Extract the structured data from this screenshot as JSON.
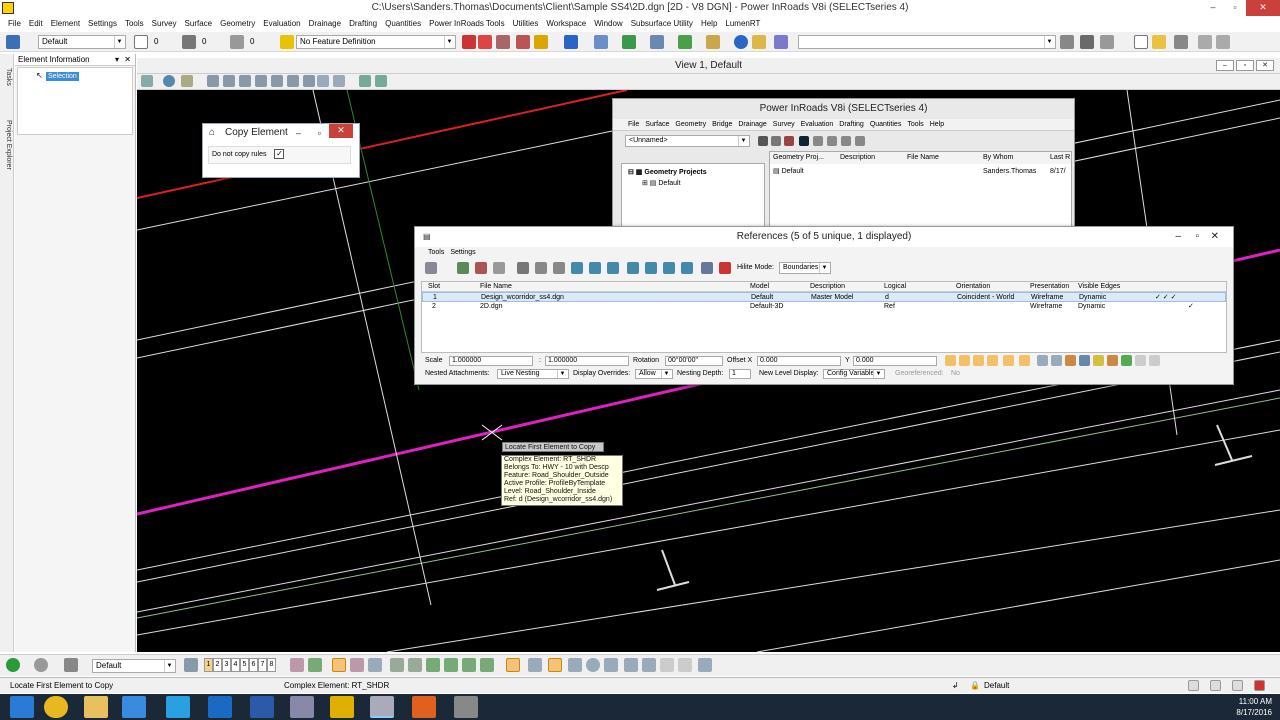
{
  "window": {
    "title": "C:\\Users\\Sanders.Thomas\\Documents\\Client\\Sample SS4\\2D.dgn [2D - V8 DGN] - Power InRoads V8i (SELECTseries 4)"
  },
  "menu": [
    "File",
    "Edit",
    "Element",
    "Settings",
    "Tools",
    "Survey",
    "Surface",
    "Geometry",
    "Evaluation",
    "Drainage",
    "Drafting",
    "Quantities",
    "Power InRoads Tools",
    "Utilities",
    "Workspace",
    "Window",
    "Subsurface Utility",
    "Help",
    "LumenRT"
  ],
  "toolbar": {
    "level": "Default",
    "color_value": "0",
    "weight_value": "0",
    "style_value": "0",
    "feature_definition": "No Feature Definition"
  },
  "side_tabs": [
    "Tasks",
    "Project Explorer"
  ],
  "element_info": {
    "title": "Element Information",
    "selection": "Selection"
  },
  "view": {
    "title": "View 1, Default"
  },
  "copy_element": {
    "title": "Copy Element",
    "option_label": "Do not copy rules",
    "checked": true,
    "check_mark": "✓"
  },
  "pir": {
    "title": "Power InRoads V8i (SELECTseries 4)",
    "menu": [
      "File",
      "Surface",
      "Geometry",
      "Bridge",
      "Drainage",
      "Survey",
      "Evaluation",
      "Drafting",
      "Quantities",
      "Tools",
      "Help"
    ],
    "combo": "<Unnamed>",
    "tree_root": "Geometry Projects",
    "tree_child": "Default",
    "columns": [
      "Geometry Proj...",
      "Description",
      "File Name",
      "By Whom",
      "Last R"
    ],
    "row": {
      "name": "Default",
      "by": "Sanders.Thomas",
      "date": "8/17/"
    }
  },
  "references": {
    "title": "References (5 of 5 unique, 1 displayed)",
    "menu": [
      "Tools",
      "Settings"
    ],
    "hilite_label": "Hilite Mode:",
    "hilite_value": "Boundaries",
    "columns": [
      "Slot",
      "File Name",
      "Model",
      "Description",
      "Logical",
      "Orientation",
      "Presentation",
      "Visible Edges"
    ],
    "rows": [
      {
        "slot": "1",
        "file": "Design_wcorridor_ss4.dgn",
        "model": "Default",
        "description": "Master Model",
        "logical": "d",
        "orientation": "Coincident - World",
        "presentation": "Wireframe",
        "edges": "Dynamic",
        "checks": "✓  ✓  ✓"
      },
      {
        "slot": "2",
        "file": "2D.dgn",
        "model": "Default-3D",
        "description": "",
        "logical": "Ref",
        "orientation": "",
        "presentation": "Wireframe",
        "edges": "Dynamic",
        "checks": "✓"
      }
    ],
    "scale_label": "Scale",
    "scale1": "1.000000",
    "scale_sep": ":",
    "scale2": "1.000000",
    "rotation_label": "Rotation",
    "rotation": "00°00'00\"",
    "offset_x_label": "Offset X",
    "offset_x": "0.000",
    "y_label": "Y",
    "offset_y": "0.000",
    "nested_label": "Nested Attachments:",
    "nested_value": "Live Nesting",
    "display_overrides_label": "Display Overrides:",
    "display_overrides_value": "Allow",
    "nesting_depth_label": "Nesting Depth:",
    "nesting_depth": "1",
    "new_level_label": "New Level Display:",
    "new_level_value": "Config Variable",
    "georef_label": "Georeferenced:",
    "georef_value": "No"
  },
  "tooltip": {
    "prompt": "Locate First Element to Copy",
    "lines": [
      "Complex Element: RT_SHDR",
      "Belongs To: HWY - 10 with Descp",
      "Feature: Road_Shoulder_Outside",
      "Active Profile: ProfileByTemplate",
      "Level: Road_Shoulder_Inside",
      "Ref: d (Design_wcorridor_ss4.dgn)"
    ]
  },
  "bottom_tools": {
    "level": "Default",
    "view_numbers": [
      "1",
      "2",
      "3",
      "4",
      "5",
      "6",
      "7",
      "8"
    ]
  },
  "status": {
    "prompt": "Locate First Element to Copy",
    "message": "Complex Element: RT_SHDR",
    "level": "Default"
  },
  "taskbar": {
    "time": "11:00 AM",
    "date": "8/17/2016"
  }
}
